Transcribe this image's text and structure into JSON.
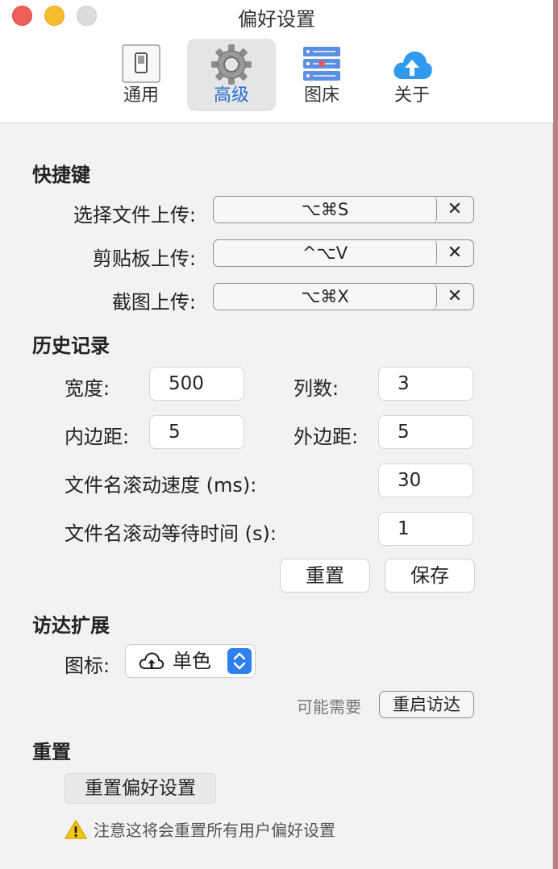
{
  "window": {
    "title": "偏好设置"
  },
  "tabs": [
    {
      "label": "通用",
      "icon": "switch-icon"
    },
    {
      "label": "高级",
      "icon": "gear-icon",
      "active": true
    },
    {
      "label": "图床",
      "icon": "server-icon"
    },
    {
      "label": "关于",
      "icon": "cloud-upload-icon"
    }
  ],
  "shortcuts": {
    "title": "快捷键",
    "items": [
      {
        "label": "选择文件上传:",
        "keys": "⌥⌘S",
        "clear": "✕"
      },
      {
        "label": "剪贴板上传:",
        "keys": "^⌥V",
        "clear": "✕"
      },
      {
        "label": "截图上传:",
        "keys": "⌥⌘X",
        "clear": "✕"
      }
    ]
  },
  "history": {
    "title": "历史记录",
    "width_label": "宽度:",
    "width_value": "500",
    "columns_label": "列数:",
    "columns_value": "3",
    "padding_label": "内边距:",
    "padding_value": "5",
    "margin_label": "外边距:",
    "margin_value": "5",
    "scroll_speed_label": "文件名滚动速度 (ms):",
    "scroll_speed_value": "30",
    "scroll_wait_label": "文件名滚动等待时间 (s):",
    "scroll_wait_value": "1",
    "reset_label": "重置",
    "save_label": "保存"
  },
  "finder": {
    "title": "访达扩展",
    "icon_label": "图标:",
    "icon_selected": "单色",
    "hint": "可能需要",
    "restart_label": "重启访达"
  },
  "reset": {
    "title": "重置",
    "button_label": "重置偏好设置",
    "warning": "注意这将会重置所有用户偏好设置"
  },
  "colors": {
    "accent": "#2f80ed",
    "active_tab_text": "#2b6fd6"
  }
}
